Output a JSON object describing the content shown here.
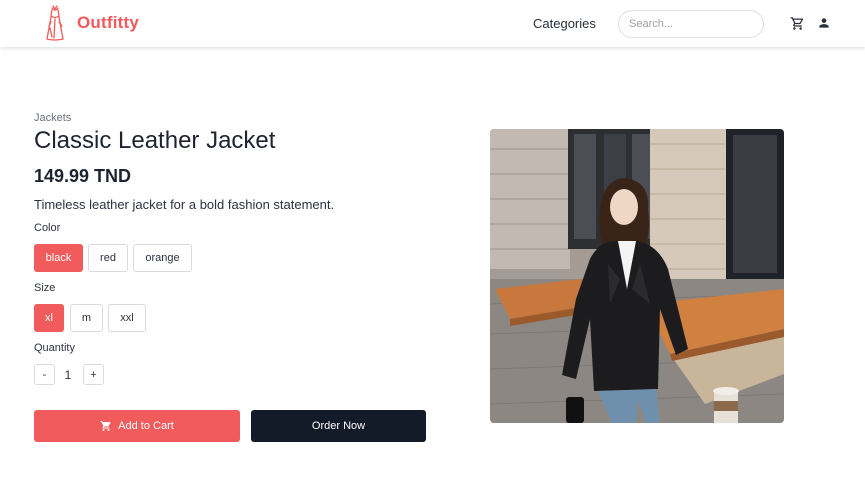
{
  "header": {
    "brand": "Outfitty",
    "nav_categories": "Categories",
    "search_placeholder": "Search...",
    "icons": [
      "dress-logo-icon",
      "cart-icon",
      "user-icon"
    ]
  },
  "product": {
    "category": "Jackets",
    "name": "Classic Leather Jacket",
    "price": "149.99 TND",
    "description": "Timeless leather jacket for a bold fashion statement.",
    "color_label": "Color",
    "colors": [
      "black",
      "red",
      "orange"
    ],
    "selected_color": "black",
    "size_label": "Size",
    "sizes": [
      "xl",
      "m",
      "xxl"
    ],
    "selected_size": "xl",
    "quantity_label": "Quantity",
    "quantity": "1",
    "decrement": "-",
    "increment": "+",
    "add_to_cart": "Add to Cart",
    "order_now": "Order Now"
  },
  "colors": {
    "accent": "#f15b5b",
    "dark_button": "#131a28"
  }
}
